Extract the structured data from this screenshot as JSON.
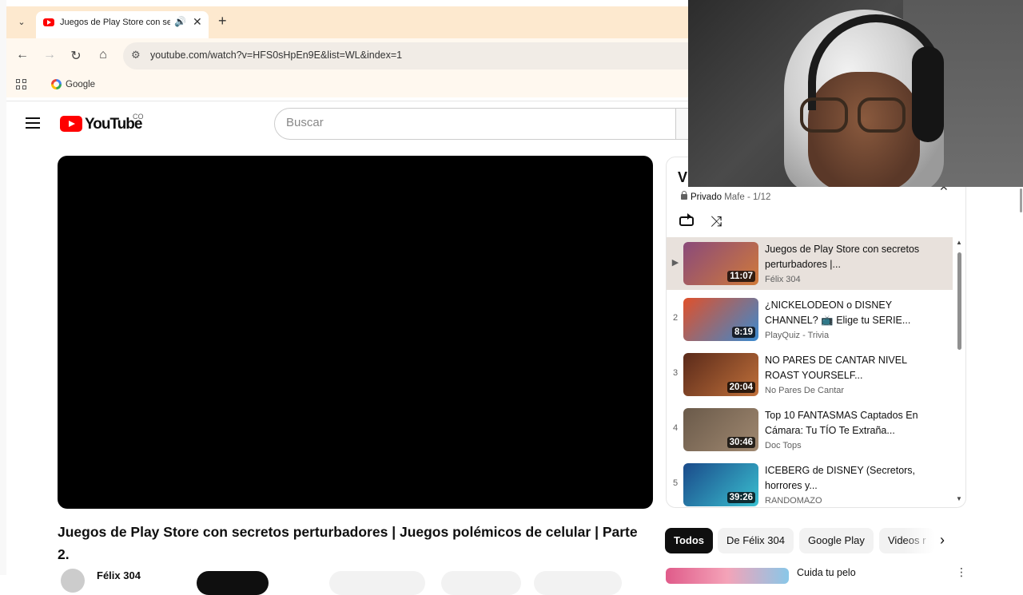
{
  "browser": {
    "tab_title": "Juegos de Play Store con se",
    "new_tab": "+",
    "url": "youtube.com/watch?v=HFS0sHpEn9E&list=WL&index=1",
    "bookmark_google": "Google"
  },
  "youtube": {
    "logo_text": "YouTube",
    "country_code": "CO",
    "search_placeholder": "Buscar"
  },
  "video": {
    "title": "Juegos de Play Store con secretos perturbadores | Juegos polémicos de celular | Parte 2.",
    "owner": "Félix 304"
  },
  "playlist": {
    "header_letter": "V",
    "privacy": "Privado",
    "owner_position": "Mafe - 1/12",
    "items": [
      {
        "index": "▶",
        "title": "Juegos de Play Store con secretos perturbadores |...",
        "channel": "Félix 304",
        "duration": "11:07",
        "thumb_colors": [
          "#8a4a7a",
          "#d07a3a"
        ],
        "active": true
      },
      {
        "index": "2",
        "title": "¿NICKELODEON o DISNEY CHANNEL? 📺 Elige tu SERIE...",
        "channel": "PlayQuiz - Trivia",
        "duration": "8:19",
        "thumb_colors": [
          "#e0502a",
          "#3a8ad0"
        ],
        "active": false
      },
      {
        "index": "3",
        "title": "NO PARES DE CANTAR NIVEL ROAST YOURSELF...",
        "channel": "No Pares De Cantar",
        "duration": "20:04",
        "thumb_colors": [
          "#5a2a1a",
          "#c0703a"
        ],
        "active": false
      },
      {
        "index": "4",
        "title": "Top 10 FANTASMAS Captados En Cámara: Tu TÍO Te Extraña...",
        "channel": "Doc Tops",
        "duration": "30:46",
        "thumb_colors": [
          "#6a5a4a",
          "#a08870"
        ],
        "active": false
      },
      {
        "index": "5",
        "title": "ICEBERG de DISNEY (Secretors, horrores y...",
        "channel": "RANDOMAZO",
        "duration": "39:26",
        "thumb_colors": [
          "#1a4a8a",
          "#3ac0d0"
        ],
        "active": false
      }
    ]
  },
  "chips": [
    "Todos",
    "De Félix 304",
    "Google Play",
    "Videos r"
  ],
  "recommendation": {
    "title": "Cuida tu pelo"
  },
  "colors": {
    "brand_red": "#ff0000",
    "tabbar": "#fde9cf",
    "active_row": "#e8e1dc"
  }
}
